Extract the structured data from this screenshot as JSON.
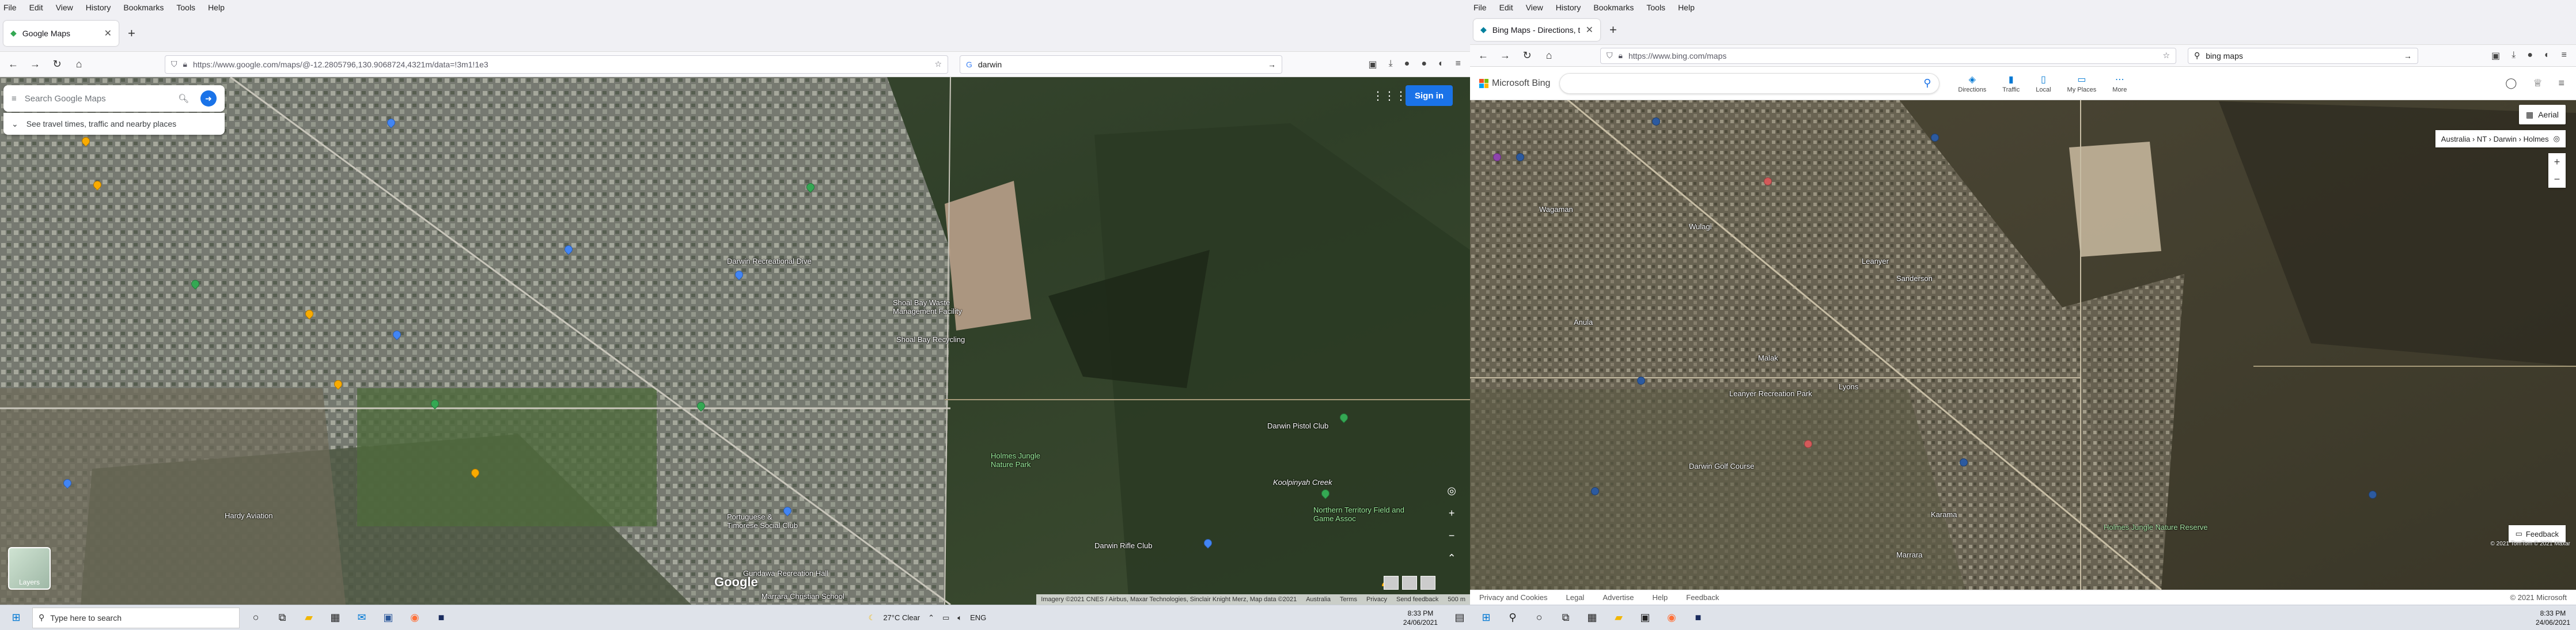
{
  "left": {
    "menu": [
      "File",
      "Edit",
      "View",
      "History",
      "Bookmarks",
      "Tools",
      "Help"
    ],
    "tab_title": "Google Maps",
    "url": "https://www.google.com/maps/@-12.2805796,130.9068724,4321m/data=!3m1!1e3",
    "search_value": "darwin",
    "map": {
      "search_placeholder": "Search Google Maps",
      "travel_text": "See travel times, traffic and nearby places",
      "signin_label": "Sign in",
      "logo": "Google",
      "layers_label": "Layers",
      "attribution": [
        "Imagery ©2021 CNES / Airbus, Maxar Technologies, Sinclair Knight Merz, Map data ©2021",
        "Australia",
        "Terms",
        "Privacy",
        "Send feedback",
        "500 m"
      ],
      "labels": [
        "Darwin Recreational Dive",
        "Shoal Bay Waste Management Facility",
        "Shoal Bay Recycling",
        "Holmes Jungle Nature Park",
        "Darwin Pistol Club",
        "Koolpinyah Creek",
        "Northern Territory Field and Game Assoc",
        "Darwin Rifle Club",
        "Portuguese & Timorese Social Club",
        "Marrara Christian School",
        "Gundawa Recreation Hall",
        "Hardy Aviation"
      ]
    },
    "taskbar": {
      "search_placeholder": "Type here to search",
      "weather": "27°C  Clear",
      "lang": "ENG",
      "time": "8:33 PM",
      "date": "24/06/2021"
    }
  },
  "right": {
    "menu": [
      "File",
      "Edit",
      "View",
      "History",
      "Bookmarks",
      "Tools",
      "Help"
    ],
    "tab_title": "Bing Maps - Directions, trip pl...",
    "url": "https://www.bing.com/maps",
    "search_value": "bing maps",
    "map": {
      "logo_text": "Microsoft Bing",
      "nav": [
        "Directions",
        "Traffic",
        "Local",
        "My Places",
        "More"
      ],
      "aerial_label": "Aerial",
      "breadcrumb": "Australia › NT › Darwin › Holmes",
      "feedback_label": "Feedback",
      "copyright": "© 2021 TomTom © 2021 Maxar",
      "footer": [
        "Privacy and Cookies",
        "Legal",
        "Advertise",
        "Help",
        "Feedback"
      ],
      "footer_right": "© 2021 Microsoft",
      "labels": [
        "Wagaman",
        "Wulagi",
        "Leanyer",
        "Anula",
        "Malak",
        "Karama",
        "Marrara",
        "Holmes Jungle Nature Reserve",
        "Darwin Golf Course",
        "Lyons",
        "Sanderson",
        "Leanyer Recreation Park"
      ]
    },
    "taskbar": {
      "time": "8:33 PM",
      "date": "24/06/2021"
    }
  }
}
